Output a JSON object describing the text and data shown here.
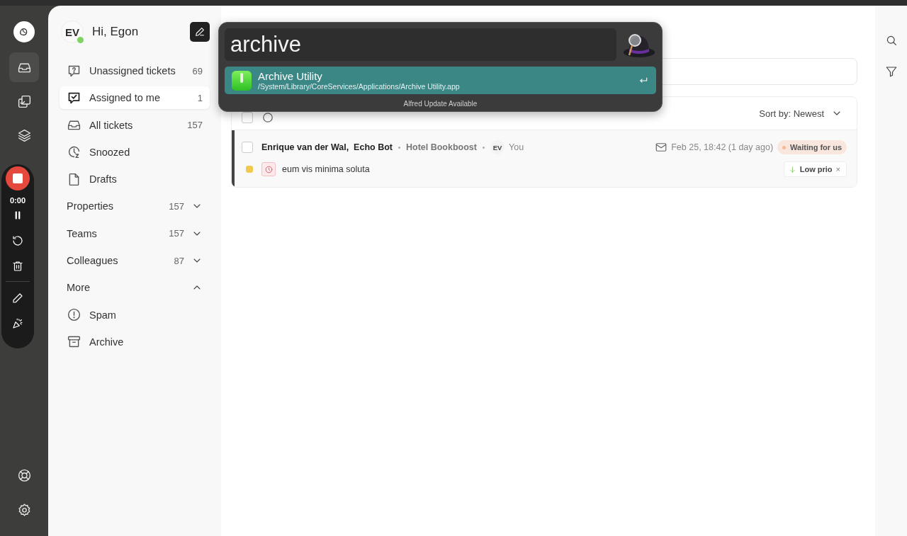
{
  "rail": {
    "items": [
      {
        "selected": true
      },
      {
        "selected": false
      },
      {
        "selected": false
      }
    ]
  },
  "recorder": {
    "time": "0:00"
  },
  "sidebar": {
    "user": {
      "initials": "EV",
      "greeting": "Hi, Egon",
      "online": true
    },
    "items": [
      {
        "label": "Unassigned tickets",
        "count": "69",
        "selected": false
      },
      {
        "label": "Assigned to me",
        "count": "1",
        "selected": true
      },
      {
        "label": "All tickets",
        "count": "157",
        "selected": false
      },
      {
        "label": "Snoozed",
        "selected": false
      },
      {
        "label": "Drafts",
        "selected": false
      }
    ],
    "sections": [
      {
        "label": "Properties",
        "count": "157",
        "expanded": false
      },
      {
        "label": "Teams",
        "count": "157",
        "expanded": false
      },
      {
        "label": "Colleagues",
        "count": "87",
        "expanded": false
      },
      {
        "label": "More",
        "expanded": true,
        "children": [
          {
            "label": "Spam"
          },
          {
            "label": "Archive"
          }
        ]
      }
    ]
  },
  "launcher": {
    "query": "archive",
    "results": [
      {
        "title": "Archive Utility",
        "path": "/System/Library/CoreServices/Applications/Archive Utility.app",
        "selected": true
      }
    ],
    "footer": "Alfred Update Available"
  },
  "list": {
    "sort": "Sort by: Newest",
    "header_checked": false,
    "tickets": [
      {
        "selected": true,
        "checked": false,
        "participants": "Enrique van der Wal,  Echo Bot",
        "company": "Hotel Bookboost",
        "assignee_initials": "EV",
        "assignee": "You",
        "date": "Feb 25, 18:42 (1 day ago)",
        "status": {
          "label": "Waiting for us",
          "color": "#f7b89a"
        },
        "subject": "eum vis minima soluta",
        "priority": "Low prio",
        "remove_label": "×"
      }
    ]
  }
}
